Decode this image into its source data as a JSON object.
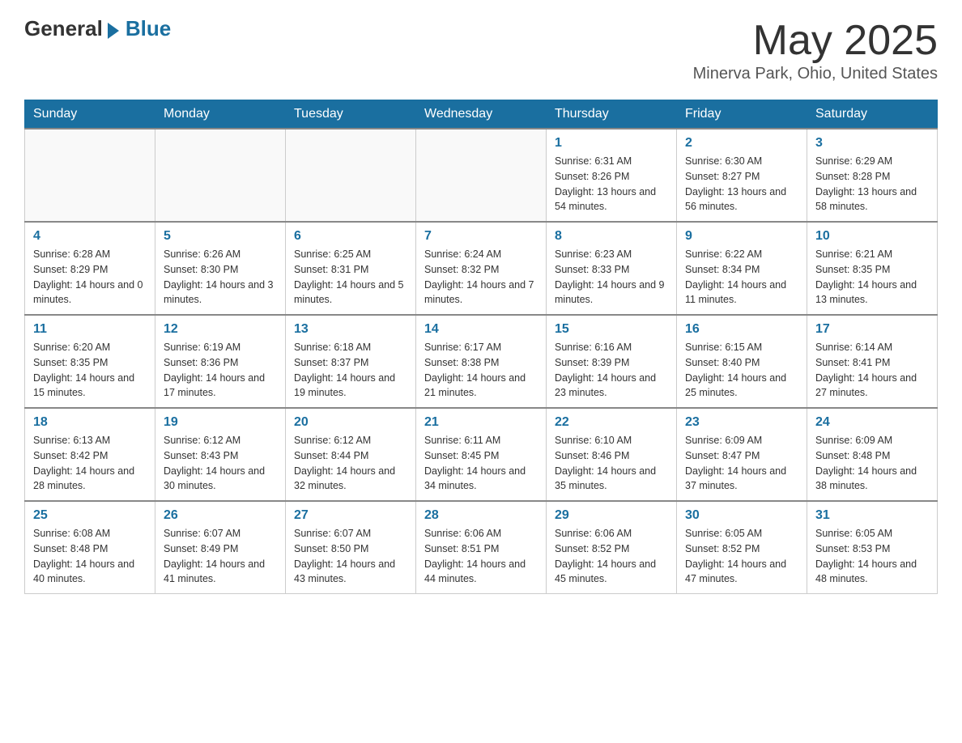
{
  "header": {
    "logo_general": "General",
    "logo_blue": "Blue",
    "month_year": "May 2025",
    "location": "Minerva Park, Ohio, United States"
  },
  "days_of_week": [
    "Sunday",
    "Monday",
    "Tuesday",
    "Wednesday",
    "Thursday",
    "Friday",
    "Saturday"
  ],
  "weeks": [
    [
      {
        "day": "",
        "sunrise": "",
        "sunset": "",
        "daylight": ""
      },
      {
        "day": "",
        "sunrise": "",
        "sunset": "",
        "daylight": ""
      },
      {
        "day": "",
        "sunrise": "",
        "sunset": "",
        "daylight": ""
      },
      {
        "day": "",
        "sunrise": "",
        "sunset": "",
        "daylight": ""
      },
      {
        "day": "1",
        "sunrise": "Sunrise: 6:31 AM",
        "sunset": "Sunset: 8:26 PM",
        "daylight": "Daylight: 13 hours and 54 minutes."
      },
      {
        "day": "2",
        "sunrise": "Sunrise: 6:30 AM",
        "sunset": "Sunset: 8:27 PM",
        "daylight": "Daylight: 13 hours and 56 minutes."
      },
      {
        "day": "3",
        "sunrise": "Sunrise: 6:29 AM",
        "sunset": "Sunset: 8:28 PM",
        "daylight": "Daylight: 13 hours and 58 minutes."
      }
    ],
    [
      {
        "day": "4",
        "sunrise": "Sunrise: 6:28 AM",
        "sunset": "Sunset: 8:29 PM",
        "daylight": "Daylight: 14 hours and 0 minutes."
      },
      {
        "day": "5",
        "sunrise": "Sunrise: 6:26 AM",
        "sunset": "Sunset: 8:30 PM",
        "daylight": "Daylight: 14 hours and 3 minutes."
      },
      {
        "day": "6",
        "sunrise": "Sunrise: 6:25 AM",
        "sunset": "Sunset: 8:31 PM",
        "daylight": "Daylight: 14 hours and 5 minutes."
      },
      {
        "day": "7",
        "sunrise": "Sunrise: 6:24 AM",
        "sunset": "Sunset: 8:32 PM",
        "daylight": "Daylight: 14 hours and 7 minutes."
      },
      {
        "day": "8",
        "sunrise": "Sunrise: 6:23 AM",
        "sunset": "Sunset: 8:33 PM",
        "daylight": "Daylight: 14 hours and 9 minutes."
      },
      {
        "day": "9",
        "sunrise": "Sunrise: 6:22 AM",
        "sunset": "Sunset: 8:34 PM",
        "daylight": "Daylight: 14 hours and 11 minutes."
      },
      {
        "day": "10",
        "sunrise": "Sunrise: 6:21 AM",
        "sunset": "Sunset: 8:35 PM",
        "daylight": "Daylight: 14 hours and 13 minutes."
      }
    ],
    [
      {
        "day": "11",
        "sunrise": "Sunrise: 6:20 AM",
        "sunset": "Sunset: 8:35 PM",
        "daylight": "Daylight: 14 hours and 15 minutes."
      },
      {
        "day": "12",
        "sunrise": "Sunrise: 6:19 AM",
        "sunset": "Sunset: 8:36 PM",
        "daylight": "Daylight: 14 hours and 17 minutes."
      },
      {
        "day": "13",
        "sunrise": "Sunrise: 6:18 AM",
        "sunset": "Sunset: 8:37 PM",
        "daylight": "Daylight: 14 hours and 19 minutes."
      },
      {
        "day": "14",
        "sunrise": "Sunrise: 6:17 AM",
        "sunset": "Sunset: 8:38 PM",
        "daylight": "Daylight: 14 hours and 21 minutes."
      },
      {
        "day": "15",
        "sunrise": "Sunrise: 6:16 AM",
        "sunset": "Sunset: 8:39 PM",
        "daylight": "Daylight: 14 hours and 23 minutes."
      },
      {
        "day": "16",
        "sunrise": "Sunrise: 6:15 AM",
        "sunset": "Sunset: 8:40 PM",
        "daylight": "Daylight: 14 hours and 25 minutes."
      },
      {
        "day": "17",
        "sunrise": "Sunrise: 6:14 AM",
        "sunset": "Sunset: 8:41 PM",
        "daylight": "Daylight: 14 hours and 27 minutes."
      }
    ],
    [
      {
        "day": "18",
        "sunrise": "Sunrise: 6:13 AM",
        "sunset": "Sunset: 8:42 PM",
        "daylight": "Daylight: 14 hours and 28 minutes."
      },
      {
        "day": "19",
        "sunrise": "Sunrise: 6:12 AM",
        "sunset": "Sunset: 8:43 PM",
        "daylight": "Daylight: 14 hours and 30 minutes."
      },
      {
        "day": "20",
        "sunrise": "Sunrise: 6:12 AM",
        "sunset": "Sunset: 8:44 PM",
        "daylight": "Daylight: 14 hours and 32 minutes."
      },
      {
        "day": "21",
        "sunrise": "Sunrise: 6:11 AM",
        "sunset": "Sunset: 8:45 PM",
        "daylight": "Daylight: 14 hours and 34 minutes."
      },
      {
        "day": "22",
        "sunrise": "Sunrise: 6:10 AM",
        "sunset": "Sunset: 8:46 PM",
        "daylight": "Daylight: 14 hours and 35 minutes."
      },
      {
        "day": "23",
        "sunrise": "Sunrise: 6:09 AM",
        "sunset": "Sunset: 8:47 PM",
        "daylight": "Daylight: 14 hours and 37 minutes."
      },
      {
        "day": "24",
        "sunrise": "Sunrise: 6:09 AM",
        "sunset": "Sunset: 8:48 PM",
        "daylight": "Daylight: 14 hours and 38 minutes."
      }
    ],
    [
      {
        "day": "25",
        "sunrise": "Sunrise: 6:08 AM",
        "sunset": "Sunset: 8:48 PM",
        "daylight": "Daylight: 14 hours and 40 minutes."
      },
      {
        "day": "26",
        "sunrise": "Sunrise: 6:07 AM",
        "sunset": "Sunset: 8:49 PM",
        "daylight": "Daylight: 14 hours and 41 minutes."
      },
      {
        "day": "27",
        "sunrise": "Sunrise: 6:07 AM",
        "sunset": "Sunset: 8:50 PM",
        "daylight": "Daylight: 14 hours and 43 minutes."
      },
      {
        "day": "28",
        "sunrise": "Sunrise: 6:06 AM",
        "sunset": "Sunset: 8:51 PM",
        "daylight": "Daylight: 14 hours and 44 minutes."
      },
      {
        "day": "29",
        "sunrise": "Sunrise: 6:06 AM",
        "sunset": "Sunset: 8:52 PM",
        "daylight": "Daylight: 14 hours and 45 minutes."
      },
      {
        "day": "30",
        "sunrise": "Sunrise: 6:05 AM",
        "sunset": "Sunset: 8:52 PM",
        "daylight": "Daylight: 14 hours and 47 minutes."
      },
      {
        "day": "31",
        "sunrise": "Sunrise: 6:05 AM",
        "sunset": "Sunset: 8:53 PM",
        "daylight": "Daylight: 14 hours and 48 minutes."
      }
    ]
  ]
}
